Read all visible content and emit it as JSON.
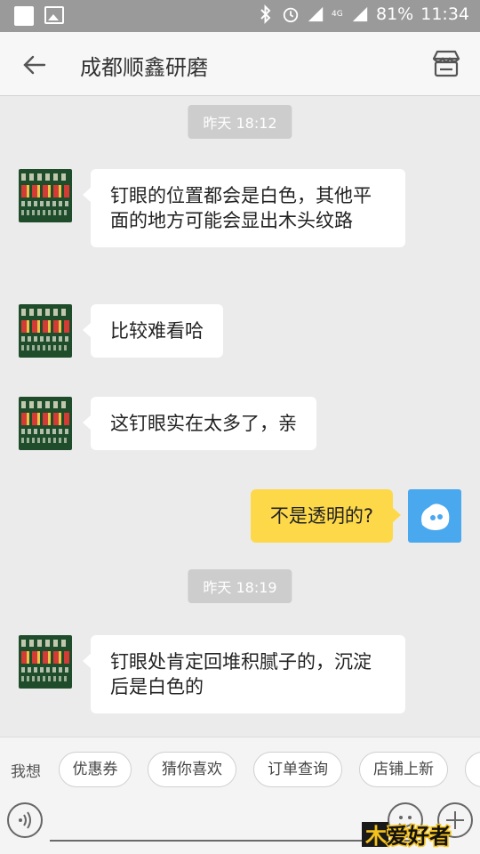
{
  "status_bar": {
    "battery": "81%",
    "time": "11:34",
    "network": "4G"
  },
  "header": {
    "title": "成都顺鑫研磨"
  },
  "messages": [
    {
      "type": "timestamp",
      "text": "昨天 18:12"
    },
    {
      "type": "received",
      "text": "钉眼的位置都会是白色，其他平面的地方可能会显出木头纹路"
    },
    {
      "type": "received",
      "text": "比较难看哈"
    },
    {
      "type": "received",
      "text": "这钉眼实在太多了，亲"
    },
    {
      "type": "sent",
      "text": "不是透明的?"
    },
    {
      "type": "timestamp",
      "text": "昨天 18:19"
    },
    {
      "type": "received",
      "text": "钉眼处肯定回堆积腻子的，沉淀后是白色的"
    }
  ],
  "quick_actions": {
    "label": "我想",
    "chips": [
      "优惠券",
      "猜你喜欢",
      "订单查询",
      "店铺上新"
    ]
  },
  "watermark": {
    "text": "爱好者"
  },
  "colors": {
    "sent_bubble": "#fdd94a",
    "received_bubble": "#ffffff",
    "background": "#ebebeb",
    "self_avatar": "#4aa8ef"
  }
}
